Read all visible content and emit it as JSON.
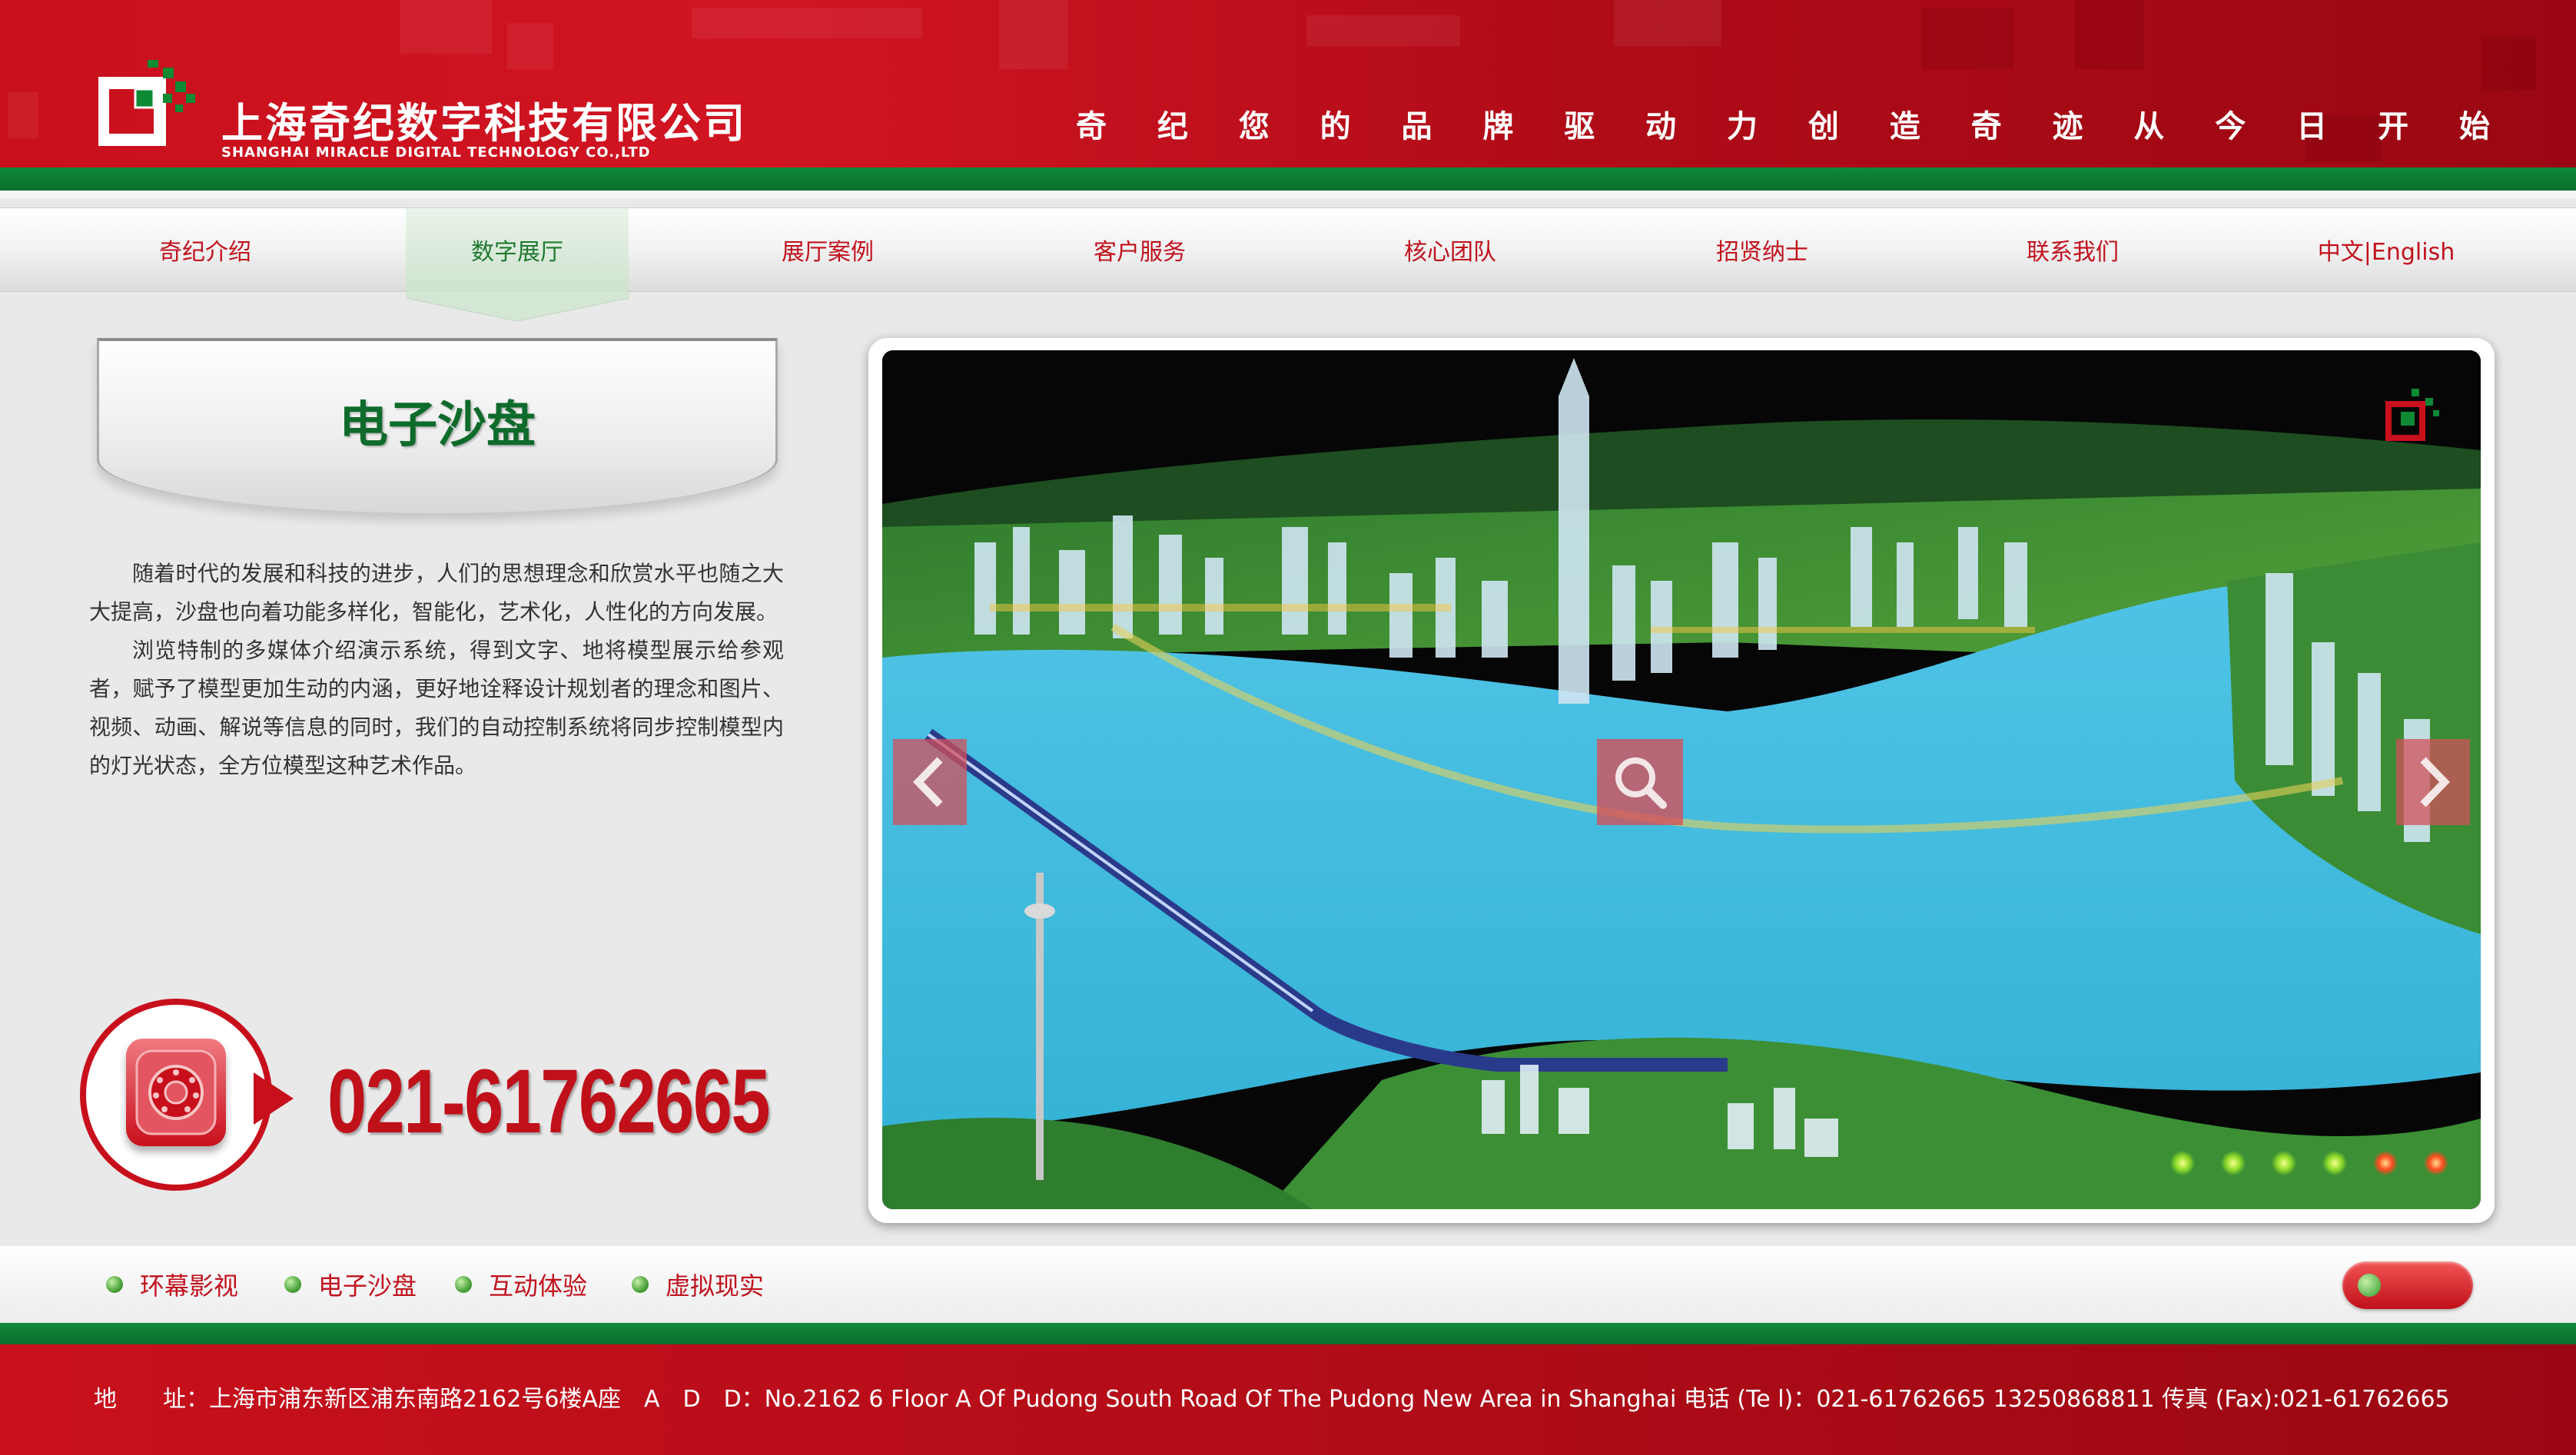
{
  "header": {
    "company_cn": "上海奇纪数字科技有限公司",
    "company_en": "SHANGHAI MIRACLE DIGITAL TECHNOLOGY CO.,LTD",
    "slogan": [
      "奇",
      "纪",
      "您",
      "的",
      "品",
      "牌",
      "驱",
      "动",
      "力",
      "创",
      "造",
      "奇",
      "迹",
      "从",
      "今",
      "日",
      "开",
      "始"
    ]
  },
  "nav": {
    "items": [
      {
        "label": "奇纪介绍"
      },
      {
        "label": "数字展厅"
      },
      {
        "label": "展厅案例"
      },
      {
        "label": "客户服务"
      },
      {
        "label": "核心团队"
      },
      {
        "label": "招贤纳士"
      },
      {
        "label": "联系我们"
      },
      {
        "label": "中文|English"
      }
    ],
    "active_index": 1
  },
  "panel": {
    "title": "电子沙盘",
    "paragraphs": [
      "随着时代的发展和科技的进步，人们的思想理念和欣赏水平也随之大大提高，沙盘也向着功能多样化，智能化，艺术化，人性化的方向发展。",
      "浏览特制的多媒体介绍演示系统，得到文字、地将模型展示给参观者，赋予了模型更加生动的内涵，更好地诠释设计规划者的理念和图片、视频、动画、解说等信息的同时，我们的自动控制系统将同步控制模型内的灯光状态，全方位模型这种艺术作品。"
    ],
    "phone": "021-61762665"
  },
  "slideshow": {
    "dots": [
      "green",
      "green",
      "green",
      "green",
      "red",
      "red"
    ],
    "current_index": 4
  },
  "sub_nav": {
    "items": [
      {
        "label": "环幕影视"
      },
      {
        "label": "电子沙盘"
      },
      {
        "label": "互动体验"
      },
      {
        "label": "虚拟现实"
      }
    ]
  },
  "footer": {
    "text": "地　　址：上海市浦东新区浦东南路2162号6楼A座　A　D　D：No.2162 6 Floor A Of Pudong South Road Of The Pudong New Area in Shanghai  电话 (Te l)：021-61762665 13250868811  传真 (Fax):021-61762665"
  },
  "colors": {
    "brand_red": "#c8101c",
    "brand_green": "#0f8a3a",
    "nav_active_text": "#1f7a30"
  },
  "icons": {
    "prev": "chevron-left-icon",
    "next": "chevron-right-icon",
    "zoom": "magnifier-icon",
    "phone": "telephone-icon"
  }
}
